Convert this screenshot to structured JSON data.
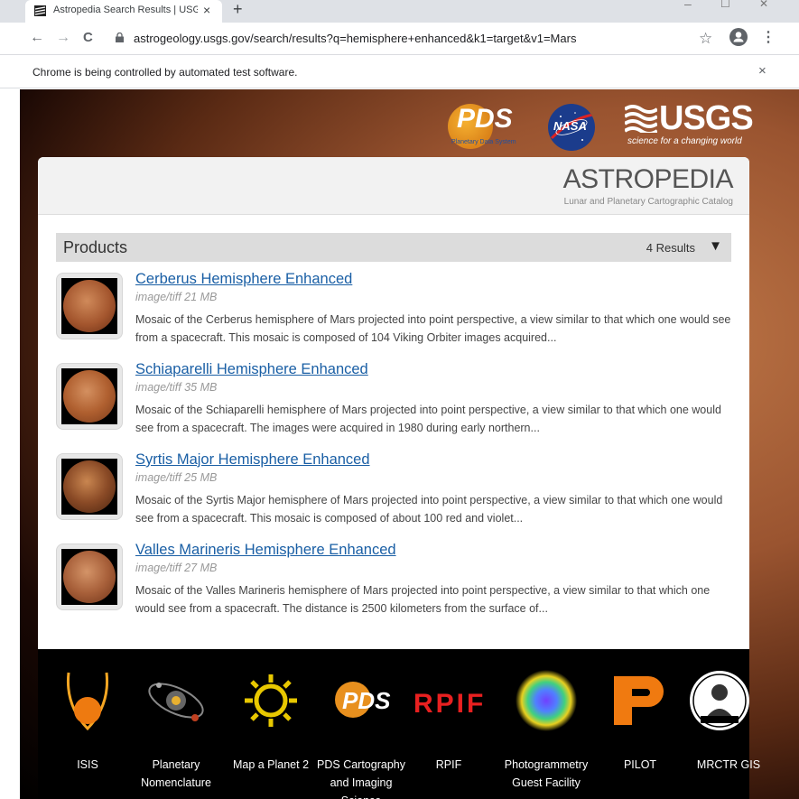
{
  "browser": {
    "tab_title": "Astropedia Search Results | USGS",
    "tab_close": "×",
    "new_tab": "+",
    "win_min": "–",
    "win_max": "☐",
    "win_close": "✕",
    "back": "←",
    "forward": "→",
    "reload": "C",
    "url": "astrogeology.usgs.gov/search/results?q=hemisphere+enhanced&k1=target&v1=Mars",
    "star": "☆",
    "menu": "⋮",
    "infobar_message": "Chrome is being controlled by automated test software.",
    "infobar_close": "×"
  },
  "header_logos": {
    "pds": "PDS",
    "pds_sub": "Planetary Data System",
    "nasa": "NASA",
    "usgs": "USGS",
    "usgs_sub": "science for a changing world"
  },
  "banner": {
    "title": "ASTROPEDIA",
    "subtitle": "Lunar and Planetary Cartographic Catalog"
  },
  "products": {
    "heading": "Products",
    "count": "4 Results",
    "toggle": "▼",
    "items": [
      {
        "title": "Cerberus Hemisphere Enhanced",
        "meta": "image/tiff 21 MB",
        "description": "Mosaic of the Cerberus hemisphere of Mars projected into point perspective, a view similar to that which one would see from a spacecraft. This mosaic is composed of 104 Viking Orbiter images acquired..."
      },
      {
        "title": "Schiaparelli Hemisphere Enhanced",
        "meta": "image/tiff 35 MB",
        "description": "Mosaic of the Schiaparelli hemisphere of Mars projected into point perspective, a view similar to that which one would see from a spacecraft. The images were acquired in 1980 during early northern..."
      },
      {
        "title": "Syrtis Major Hemisphere Enhanced",
        "meta": "image/tiff 25 MB",
        "description": "Mosaic of the Syrtis Major hemisphere of Mars projected into point perspective, a view similar to that which one would see from a spacecraft. This mosaic is composed of about 100 red and violet..."
      },
      {
        "title": "Valles Marineris Hemisphere Enhanced",
        "meta": "image/tiff 27 MB",
        "description": "Mosaic of the Valles Marineris hemisphere of Mars projected into point perspective, a view similar to that which one would see from a spacecraft. The distance is 2500 kilometers from the surface of..."
      }
    ]
  },
  "footer": {
    "items": [
      {
        "label": "ISIS",
        "icon": "isis-icon"
      },
      {
        "label": "Planetary Nomenclature",
        "icon": "nomenclature-icon"
      },
      {
        "label": "Map a Planet 2",
        "icon": "map-a-planet-icon"
      },
      {
        "label": "PDS Cartography and Imaging Science",
        "icon": "pds-icon"
      },
      {
        "label": "RPIF",
        "icon": "rpif-icon"
      },
      {
        "label": "Photogrammetry Guest Facility",
        "icon": "photogrammetry-icon"
      },
      {
        "label": "PILOT",
        "icon": "pilot-icon"
      },
      {
        "label": "MRCTR GIS",
        "icon": "mrctr-icon"
      }
    ],
    "rpif_logo": "RPIF",
    "pds_logo": "PDS"
  }
}
